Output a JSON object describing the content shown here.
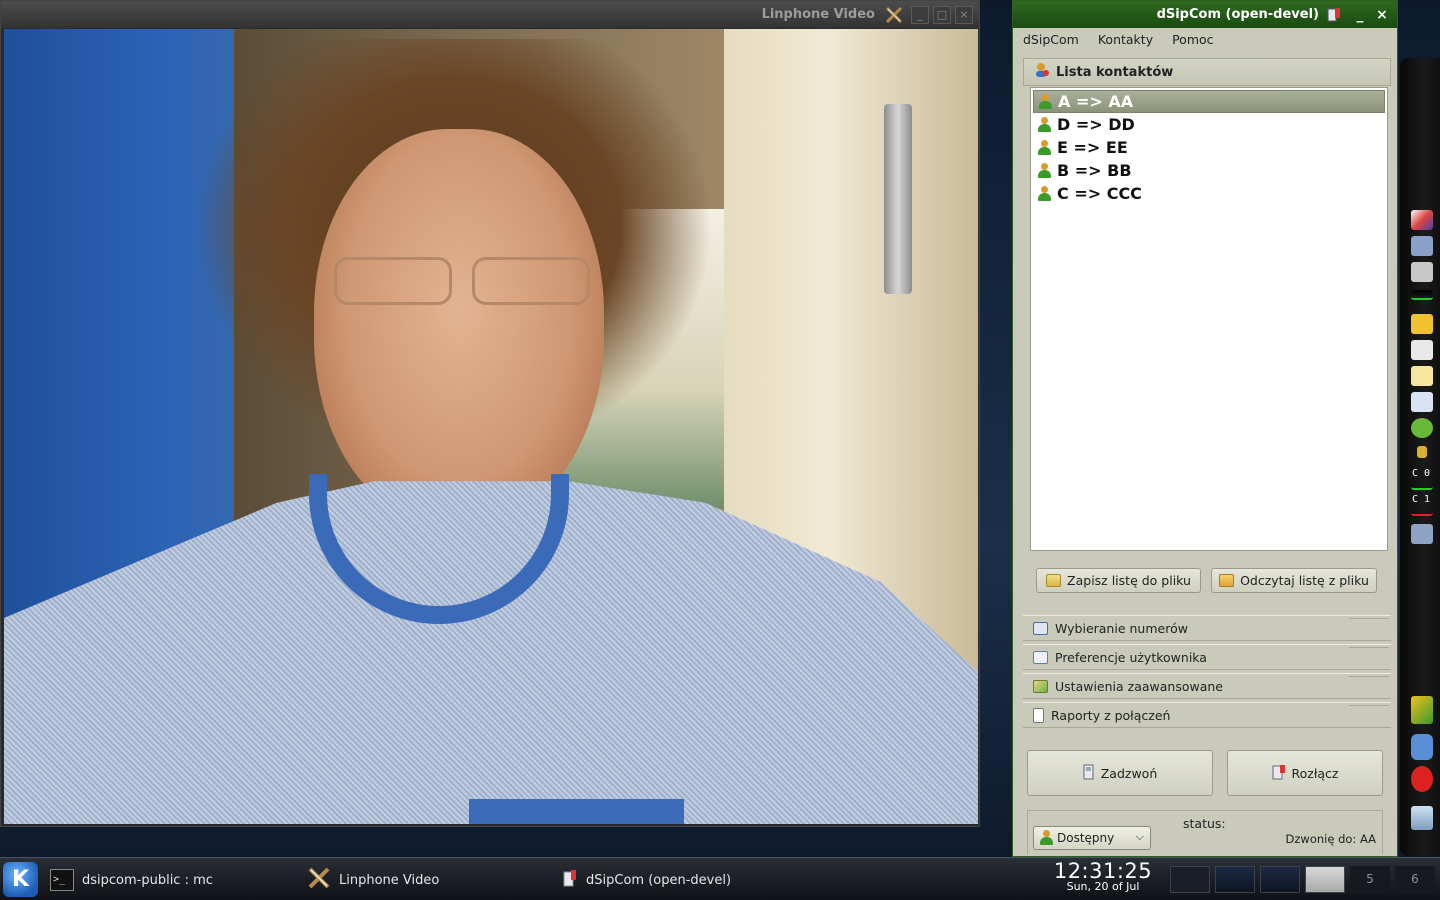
{
  "video_window": {
    "title": "Linphone Video",
    "buttons": {
      "minimize": "_",
      "maximize": "□",
      "close": "×"
    }
  },
  "dsipcom": {
    "title": "dSipCom (open-devel)",
    "title_buttons": {
      "minimize": "_",
      "close": "×"
    },
    "menu": [
      "dSipCom",
      "Kontakty",
      "Pomoc"
    ],
    "contacts_header": "Lista kontaktów",
    "contacts": [
      {
        "label": "A => AA",
        "selected": true
      },
      {
        "label": "D => DD",
        "selected": false
      },
      {
        "label": "E => EE",
        "selected": false
      },
      {
        "label": "B => BB",
        "selected": false
      },
      {
        "label": "C => CCC",
        "selected": false
      }
    ],
    "save_button": "Zapisz listę do pliku",
    "load_button": "Odczytaj listę z pliku",
    "nav": [
      {
        "label": "Wybieranie numerów",
        "icon": "dialpad-icon"
      },
      {
        "label": "Preferencje użytkownika",
        "icon": "user-card-icon"
      },
      {
        "label": "Ustawienia zaawansowane",
        "icon": "settings-check-icon"
      },
      {
        "label": "Raporty z połączeń",
        "icon": "report-icon"
      }
    ],
    "call_button": "Zadzwoń",
    "hangup_button": "Rozłącz",
    "status_label": "status:",
    "status_value": "Dostępny",
    "calling_info": "Dzwonię do: AA"
  },
  "dock": {
    "cpu_labels": [
      "C 0",
      "C 1"
    ]
  },
  "taskbar": {
    "kmenu_glyph": "K",
    "tasks": [
      {
        "label": "dsipcom-public : mc",
        "icon": "terminal-icon"
      },
      {
        "label": "Linphone Video",
        "icon": "linphone-icon"
      },
      {
        "label": "dSipCom (open-devel)",
        "icon": "dsipcom-icon"
      }
    ],
    "clock_time": "12:31:25",
    "clock_date": "Sun, 20 of Jul",
    "desktops": [
      "5",
      "6"
    ]
  },
  "colors": {
    "dsip_titlebar": "#1f5a18",
    "dsip_background": "#c9caba",
    "selection": "#8c9478",
    "taskbar": "#15181e"
  }
}
